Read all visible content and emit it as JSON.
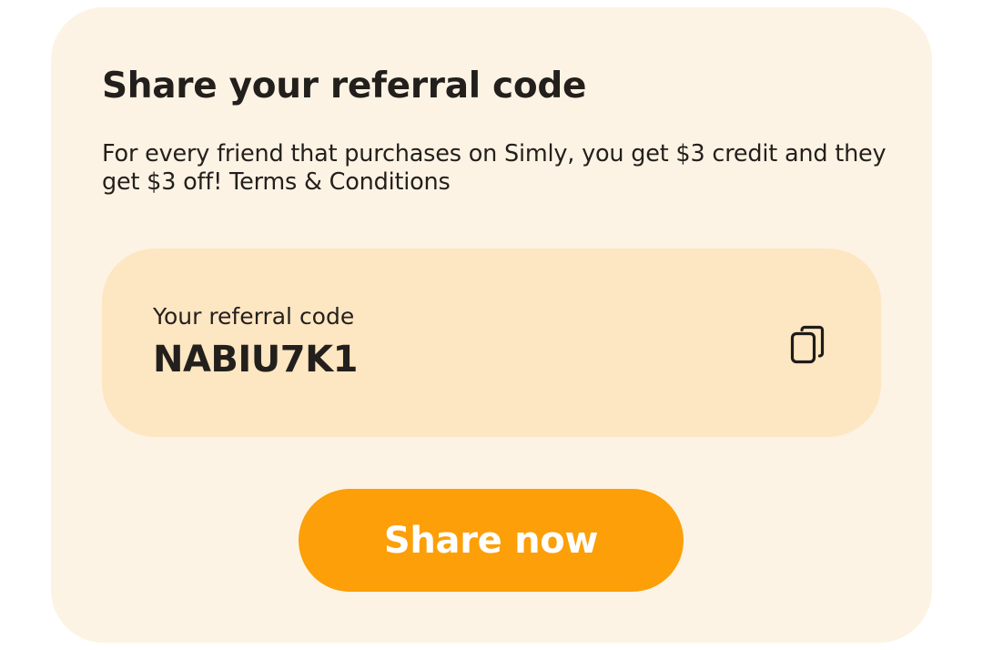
{
  "referral": {
    "title": "Share your referral code",
    "description_prefix": "For every friend that purchases on Simly, you get $3 credit and they get $3 off! ",
    "terms_link": "Terms & Conditions",
    "code_label": "Your referral code",
    "code_value": "NABIU7K1",
    "copy_icon": "copy-icon",
    "share_button_label": "Share now"
  },
  "colors": {
    "card_background": "#fdf3e4",
    "code_box_background": "#fde6c2",
    "accent": "#fc9f08",
    "text": "#231f1c"
  }
}
